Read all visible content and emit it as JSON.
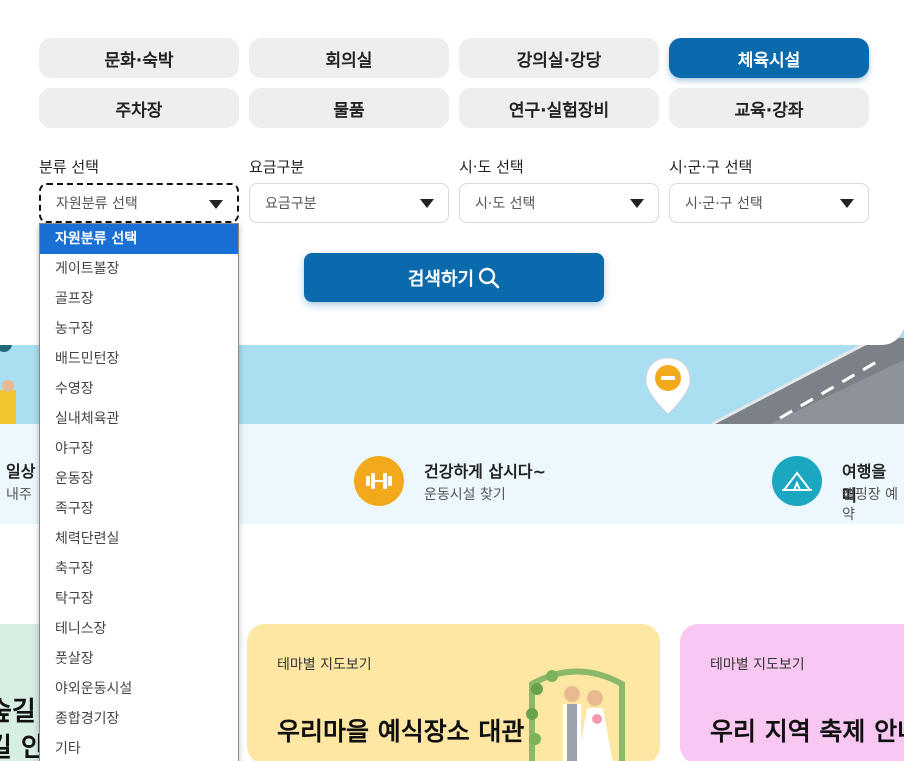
{
  "categories": [
    {
      "label": "문화·숙박",
      "active": false
    },
    {
      "label": "회의실",
      "active": false
    },
    {
      "label": "강의실·강당",
      "active": false
    },
    {
      "label": "체육시설",
      "active": true
    },
    {
      "label": "주차장",
      "active": false
    },
    {
      "label": "물품",
      "active": false
    },
    {
      "label": "연구·실험장비",
      "active": false
    },
    {
      "label": "교육·강좌",
      "active": false
    }
  ],
  "filters": [
    {
      "label": "분류 선택",
      "value": "자원분류 선택"
    },
    {
      "label": "요금구분",
      "value": "요금구분"
    },
    {
      "label": "시·도 선택",
      "value": "시·도 선택"
    },
    {
      "label": "시·군·구 선택",
      "value": "시·군·구 선택"
    }
  ],
  "search_button": {
    "label": "검색하기"
  },
  "dropdown": {
    "selected": "자원분류 선택",
    "options": [
      "자원분류 선택",
      "게이트볼장",
      "골프장",
      "농구장",
      "배드민턴장",
      "수영장",
      "실내체육관",
      "야구장",
      "운동장",
      "족구장",
      "체력단련실",
      "축구장",
      "탁구장",
      "테니스장",
      "풋살장",
      "야외운동시설",
      "종합경기장",
      "기타"
    ]
  },
  "info_items": [
    {
      "title": "일상",
      "subtitle": "내주"
    },
    {
      "title": "건강하게 삽시다~",
      "subtitle": "운동시설 찾기",
      "icon": "dumbbell-icon"
    },
    {
      "title": "여행을 떠",
      "subtitle": "캠핑장 예약",
      "icon": "tent-icon"
    }
  ],
  "cards": [
    {
      "label": "",
      "title_lines": [
        "숲길",
        "길 안"
      ]
    },
    {
      "label": "테마별 지도보기",
      "title": "우리마을 예식장소 대관"
    },
    {
      "label": "테마별 지도보기",
      "title": "우리 지역 축제 안내"
    }
  ],
  "colors": {
    "primary": "#0a6aab",
    "selected_option": "#1a6fd4",
    "banner": "#a9dff0",
    "info_strip": "#ecf8fd",
    "card_green": "#d6efe2",
    "card_yellow": "#fde7a3",
    "card_pink": "#f8c8f3",
    "dumbbell_icon": "#f2a91c",
    "tent_icon": "#1aa7bf"
  }
}
